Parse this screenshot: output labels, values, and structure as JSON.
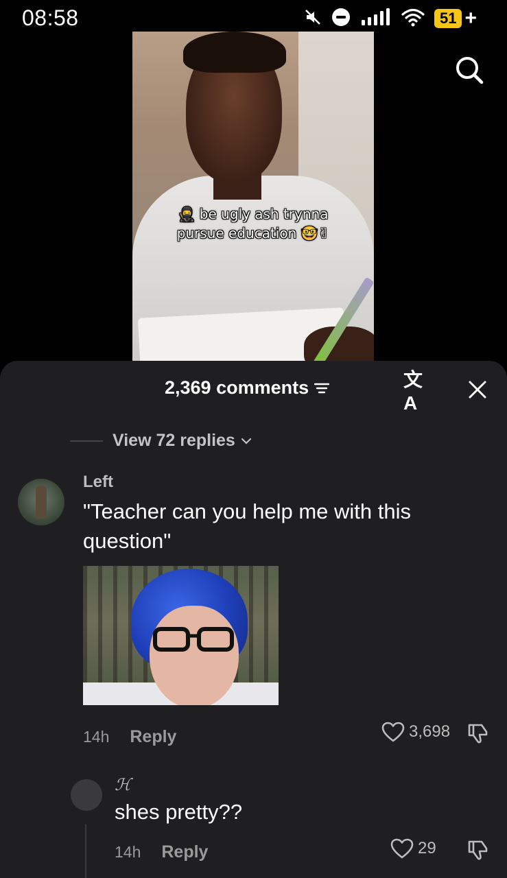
{
  "status_bar": {
    "time": "08:58",
    "battery_level": "51",
    "battery_charging_symbol": "+",
    "icons": [
      "mute-icon",
      "dnd-icon",
      "signal-icon",
      "wifi-icon",
      "battery-icon"
    ],
    "battery_color": "#f5c518"
  },
  "video": {
    "caption_line1": "be ugly ash trynna",
    "caption_line2": "pursue education",
    "caption_emoji_prefix": "🥷",
    "caption_emoji_suffix": "🤓✌"
  },
  "header": {
    "comment_count": "2,369 comments",
    "translate_label": "文A"
  },
  "thread": {
    "view_replies": "View 72 replies"
  },
  "comment": {
    "username": "Left",
    "text": "\"Teacher can you help me with this question\"",
    "age": "14h",
    "reply_label": "Reply",
    "likes": "3,698"
  },
  "reply": {
    "username": "ℋ",
    "text": "shes pretty??",
    "age": "14h",
    "reply_label": "Reply",
    "likes": "29"
  },
  "colors": {
    "sheet_bg": "#1f1f21",
    "muted_text": "#9a9a9a",
    "username_text": "#bdbdbd"
  }
}
